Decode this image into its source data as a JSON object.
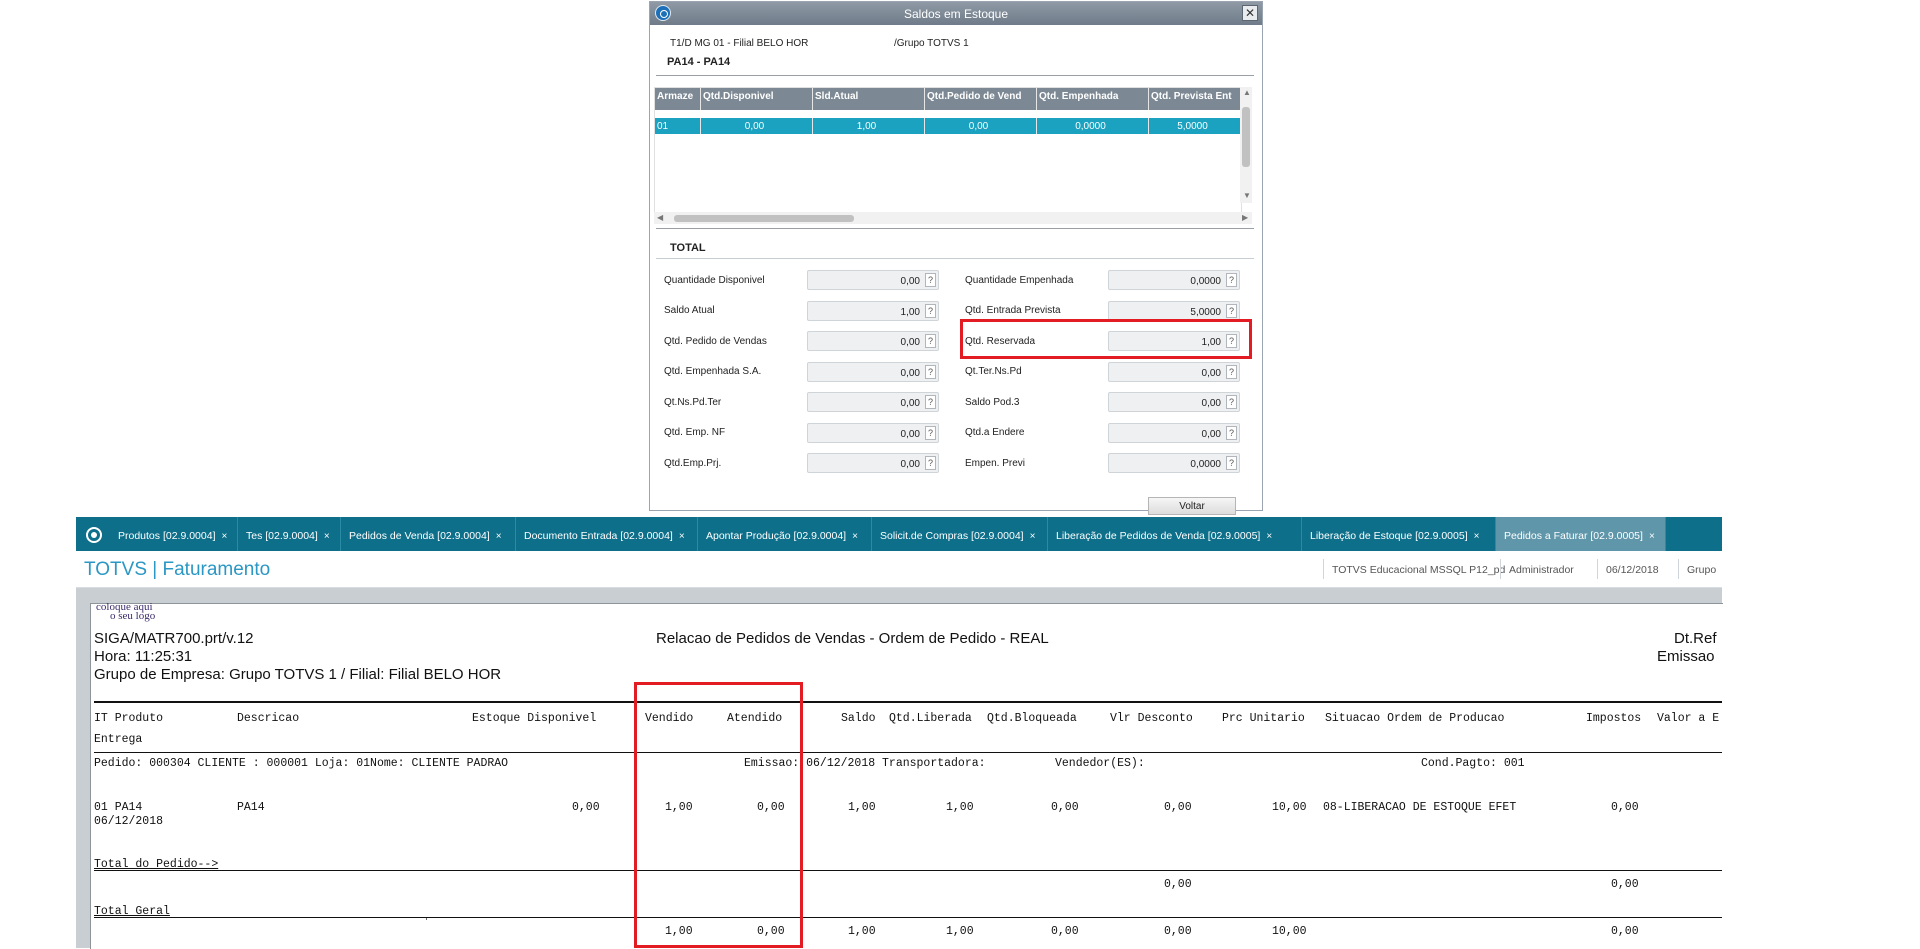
{
  "dialog": {
    "title": "Saldos em Estoque",
    "close": "✕",
    "header_left": "T1/D MG 01  - Filial BELO HOR",
    "header_right": "/Grupo TOTVS 1",
    "product": "PA14 - PA14",
    "grid": {
      "columns": [
        "Armaze",
        "Qtd.Disponivel",
        "Sld.Atual",
        "Qtd.Pedido de Vend",
        "Qtd. Empenhada",
        "Qtd. Prevista Ent"
      ],
      "row": [
        "01",
        "0,00",
        "1,00",
        "0,00",
        "0,0000",
        "5,0000"
      ]
    },
    "total_label": "TOTAL",
    "fields_left": [
      {
        "label": "Quantidade Disponivel",
        "value": "0,00"
      },
      {
        "label": "Saldo Atual",
        "value": "1,00"
      },
      {
        "label": "Qtd. Pedido de Vendas",
        "value": "0,00"
      },
      {
        "label": "Qtd. Empenhada S.A.",
        "value": "0,00"
      },
      {
        "label": "Qt.Ns.Pd.Ter",
        "value": "0,00"
      },
      {
        "label": "Qtd. Emp. NF",
        "value": "0,00"
      },
      {
        "label": "Qtd.Emp.Prj.",
        "value": "0,00"
      }
    ],
    "fields_right": [
      {
        "label": "Quantidade Empenhada",
        "value": "0,0000"
      },
      {
        "label": "Qtd. Entrada Prevista",
        "value": "5,0000"
      },
      {
        "label": "Qtd. Reservada",
        "value": "1,00"
      },
      {
        "label": "Qt.Ter.Ns.Pd",
        "value": "0,00"
      },
      {
        "label": "Saldo Pod.3",
        "value": "0,00"
      },
      {
        "label": "Qtd.a Endere",
        "value": "0,00"
      },
      {
        "label": "Empen. Previ",
        "value": "0,0000"
      }
    ],
    "help": "?",
    "voltar": "Voltar"
  },
  "tabs": [
    {
      "label": "Produtos [02.9.0004]"
    },
    {
      "label": "Tes [02.9.0004]"
    },
    {
      "label": "Pedidos de Venda [02.9.0004]"
    },
    {
      "label": "Documento Entrada [02.9.0004]"
    },
    {
      "label": "Apontar Produção [02.9.0004]"
    },
    {
      "label": "Solicit.de Compras [02.9.0004]"
    },
    {
      "label": "Liberação de Pedidos de Venda [02.9.0005]"
    },
    {
      "label": "Liberação de Estoque [02.9.0005]"
    },
    {
      "label": "Pedidos a Faturar [02.9.0005]"
    }
  ],
  "tab_close": "×",
  "app": {
    "title": "TOTVS | Faturamento",
    "environment": "TOTVS Educacional MSSQL P12_pd",
    "user": "Administrador",
    "date": "06/12/2018",
    "group": "Grupo"
  },
  "report": {
    "logo_line1": "coloque aqui",
    "logo_line2": "o seu logo",
    "program": "SIGA/MATR700.prt/v.12",
    "time": "Hora: 11:25:31",
    "group": "Grupo de Empresa: Grupo TOTVS 1 / Filial: Filial BELO HOR",
    "title": "Relacao de Pedidos de Vendas  - Ordem de Pedido - REAL",
    "dtref": "Dt.Ref",
    "emissao": "Emissao",
    "col_it_produto": "IT Produto",
    "col_descricao": "Descricao",
    "col_estoque": "Estoque Disponivel",
    "col_vendido": "Vendido",
    "col_atendido": "Atendido",
    "col_saldo": "Saldo",
    "col_qtd_liberada": "Qtd.Liberada",
    "col_qtd_bloqueada": "Qtd.Bloqueada",
    "col_vlr_desconto": "Vlr Desconto",
    "col_prc_unitario": "Prc Unitario",
    "col_situacao": "Situacao Ordem de Producao",
    "col_impostos": "Impostos",
    "col_valor": "Valor a E",
    "col_entrega": "Entrega",
    "order_pedido": "Pedido:  000304   CLIENTE : 000001 Loja:  01Nome:  CLIENTE PADRAO",
    "order_emissao": "Emissao:  06/12/2018 Transportadora:",
    "order_vendedor": "Vendedor(ES):",
    "order_cond": "Cond.Pagto:  001",
    "item": {
      "it_produto": "01 PA14",
      "entrega": "06/12/2018",
      "descricao": "PA14",
      "estoque": "0,00",
      "vendido": "1,00",
      "atendido": "0,00",
      "saldo": "1,00",
      "qtd_liberada": "1,00",
      "qtd_bloqueada": "0,00",
      "vlr_desconto": "0,00",
      "prc_unitario": "10,00",
      "situacao": "08-LIBERACAO DE ESTOQUE EFET",
      "impostos": "0,00"
    },
    "total_pedido_label": "Total do Pedido-->",
    "total_pedido": {
      "vlr_desconto": "0,00",
      "impostos": "0,00"
    },
    "total_geral_label": "Total Geral",
    "total_geral": {
      "vendido": "1,00",
      "atendido": "0,00",
      "saldo": "1,00",
      "qtd_liberada": "1,00",
      "qtd_bloqueada": "0,00",
      "vlr_desconto": "0,00",
      "prc_unitario": "10,00",
      "impostos": "0,00"
    }
  },
  "colors": {
    "tabbar": "#0d6f8a",
    "grid_selected": "#1aa2c0",
    "highlight": "#e31b23",
    "app_title": "#2b97c4"
  }
}
